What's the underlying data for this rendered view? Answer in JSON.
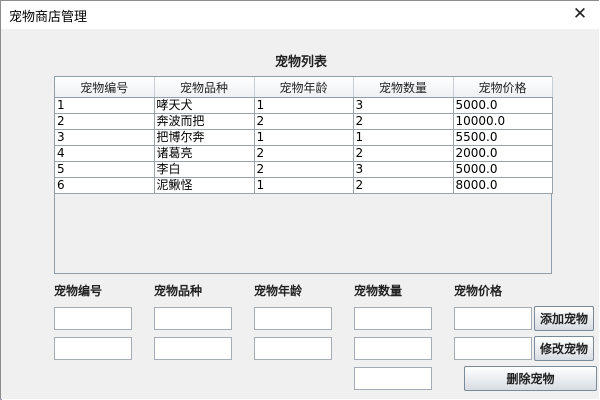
{
  "window": {
    "title": "宠物商店管理"
  },
  "list_title": "宠物列表",
  "table": {
    "columns": [
      "宠物编号",
      "宠物品种",
      "宠物年龄",
      "宠物数量",
      "宠物价格"
    ],
    "rows": [
      [
        "1",
        "哮天犬",
        "1",
        "3",
        "5000.0"
      ],
      [
        "2",
        "奔波而把",
        "2",
        "2",
        "10000.0"
      ],
      [
        "3",
        "把博尔奔",
        "1",
        "1",
        "5500.0"
      ],
      [
        "4",
        "诸葛亮",
        "2",
        "2",
        "2000.0"
      ],
      [
        "5",
        "李白",
        "2",
        "3",
        "5000.0"
      ],
      [
        "6",
        "泥鳅怪",
        "1",
        "2",
        "8000.0"
      ]
    ]
  },
  "form": {
    "labels": [
      "宠物编号",
      "宠物品种",
      "宠物年龄",
      "宠物数量",
      "宠物价格"
    ],
    "row1_values": [
      "",
      "",
      "",
      "",
      ""
    ],
    "row2_values": [
      "",
      "",
      "",
      "",
      ""
    ],
    "row3_value": ""
  },
  "buttons": {
    "add": "添加宠物",
    "edit": "修改宠物",
    "delete": "删除宠物"
  },
  "colors": {
    "window_bg": "#f0f0f0",
    "border": "#8ea0b0"
  }
}
